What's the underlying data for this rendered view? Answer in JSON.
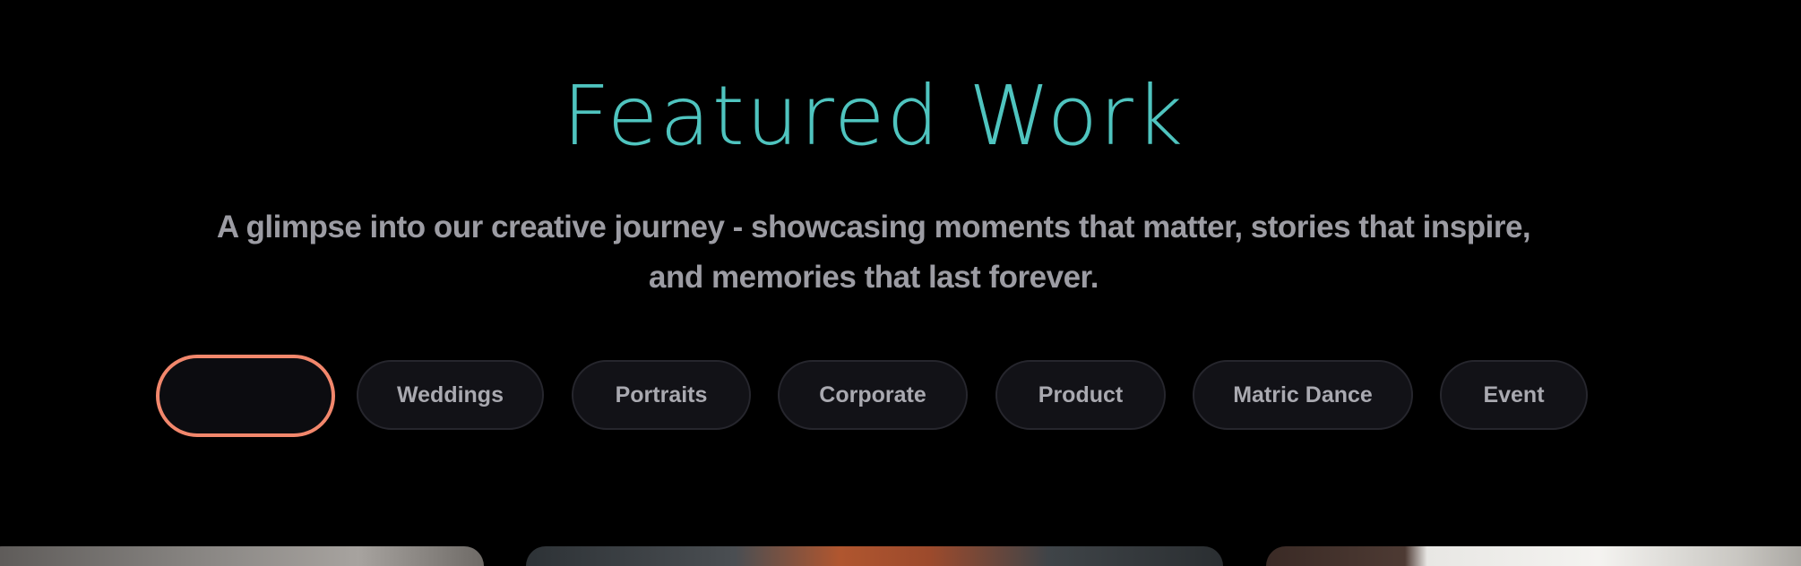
{
  "section": {
    "title": "Featured Work",
    "subtitle": "A glimpse into our creative journey - showcasing moments that matter, stories that inspire, and memories that last forever."
  },
  "filters": {
    "active_label": "",
    "items": [
      {
        "label": "Weddings"
      },
      {
        "label": "Portraits"
      },
      {
        "label": "Corporate"
      },
      {
        "label": "Product"
      },
      {
        "label": "Matric Dance"
      },
      {
        "label": "Event"
      }
    ]
  },
  "colors": {
    "background": "#000000",
    "title": "#4fc4bf",
    "subtitle": "#9c9ca3",
    "pill_background": "#121217",
    "pill_border": "#26262d",
    "pill_text": "#a9a9b0",
    "active_border": "#f2876c"
  }
}
